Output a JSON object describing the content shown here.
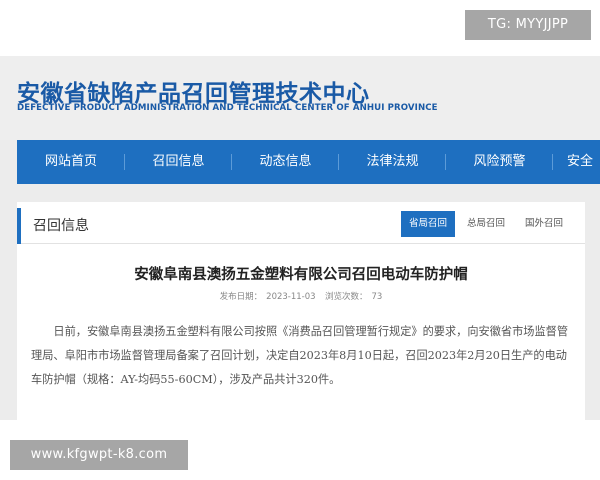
{
  "watermark": {
    "top_badge": "TG: MYYJJPP",
    "bottom_badge": "www.kfgwpt-k8.com"
  },
  "site": {
    "title_cn": "安徽省缺陷产品召回管理技术中心",
    "title_en": "DEFECTIVE PRODUCT ADMINISTRATION AND TECHNICAL CENTER OF ANHUI PROVINCE"
  },
  "nav": {
    "items": [
      {
        "label": "网站首页"
      },
      {
        "label": "召回信息"
      },
      {
        "label": "动态信息"
      },
      {
        "label": "法律法规"
      },
      {
        "label": "风险预警"
      },
      {
        "label": "安全"
      }
    ]
  },
  "section": {
    "title": "召回信息",
    "tabs": [
      {
        "label": "省局召回",
        "active": true
      },
      {
        "label": "总局召回",
        "active": false
      },
      {
        "label": "国外召回",
        "active": false
      }
    ]
  },
  "article": {
    "title": "安徽阜南县澳扬五金塑料有限公司召回电动车防护帽",
    "publish_label": "发布日期：",
    "publish_date": "2023-11-03",
    "views_label": "浏览次数：",
    "views": "73",
    "body": "日前，安徽阜南县澳扬五金塑料有限公司按照《消费品召回管理暂行规定》的要求，向安徽省市场监督管理局、阜阳市市场监督管理局备案了召回计划，决定自2023年8月10日起，召回2023年2月20日生产的电动车防护帽（规格：AY-均码55-60CM），涉及产品共计320件。"
  },
  "colors": {
    "brand_blue": "#1e6fc0",
    "title_blue": "#1a5aa6"
  }
}
